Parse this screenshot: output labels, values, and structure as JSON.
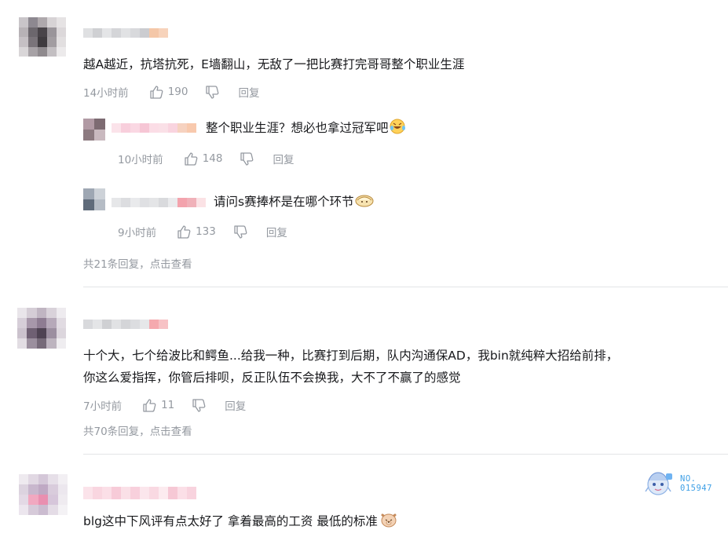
{
  "comments": [
    {
      "text": "越A越近，抗塔抗死，E墙翻山，无敌了一把比赛打完哥哥整个职业生涯",
      "time": "14小时前",
      "likes": "190",
      "reply_label": "回复",
      "replies": [
        {
          "text": "整个职业生涯？想必也拿过冠军吧",
          "emoji": "laugh-cry-emoji",
          "time": "10小时前",
          "likes": "148",
          "reply_label": "回复"
        },
        {
          "text": "请问s赛捧杯是在哪个环节",
          "emoji": "dumpling-emoji",
          "time": "9小时前",
          "likes": "133",
          "reply_label": "回复"
        }
      ],
      "more_replies": {
        "prefix": "共21条回复，",
        "action": "点击查看"
      }
    },
    {
      "text_line1": "十个大，七个给波比和鳄鱼...给我一种，比赛打到后期，队内沟通保AD，我bin就纯粹大招给前排，",
      "text_line2": "你这么爱指挥，你管后排呗，反正队伍不会换我，大不了不赢了的感觉",
      "time": "7小时前",
      "likes": "11",
      "reply_label": "回复",
      "more_replies": {
        "prefix": "共70条回复，",
        "action": "点击查看"
      }
    },
    {
      "text": "blg这中下风评有点太好了 拿着最高的工资 最低的标准",
      "emoji": "dog-emoji",
      "badge": {
        "label": "NO.",
        "number": "015947"
      }
    }
  ],
  "colors": {
    "text": "#18191c",
    "meta": "#9499a0",
    "divider": "#e3e5e7",
    "badge": "#3fa0e6"
  }
}
